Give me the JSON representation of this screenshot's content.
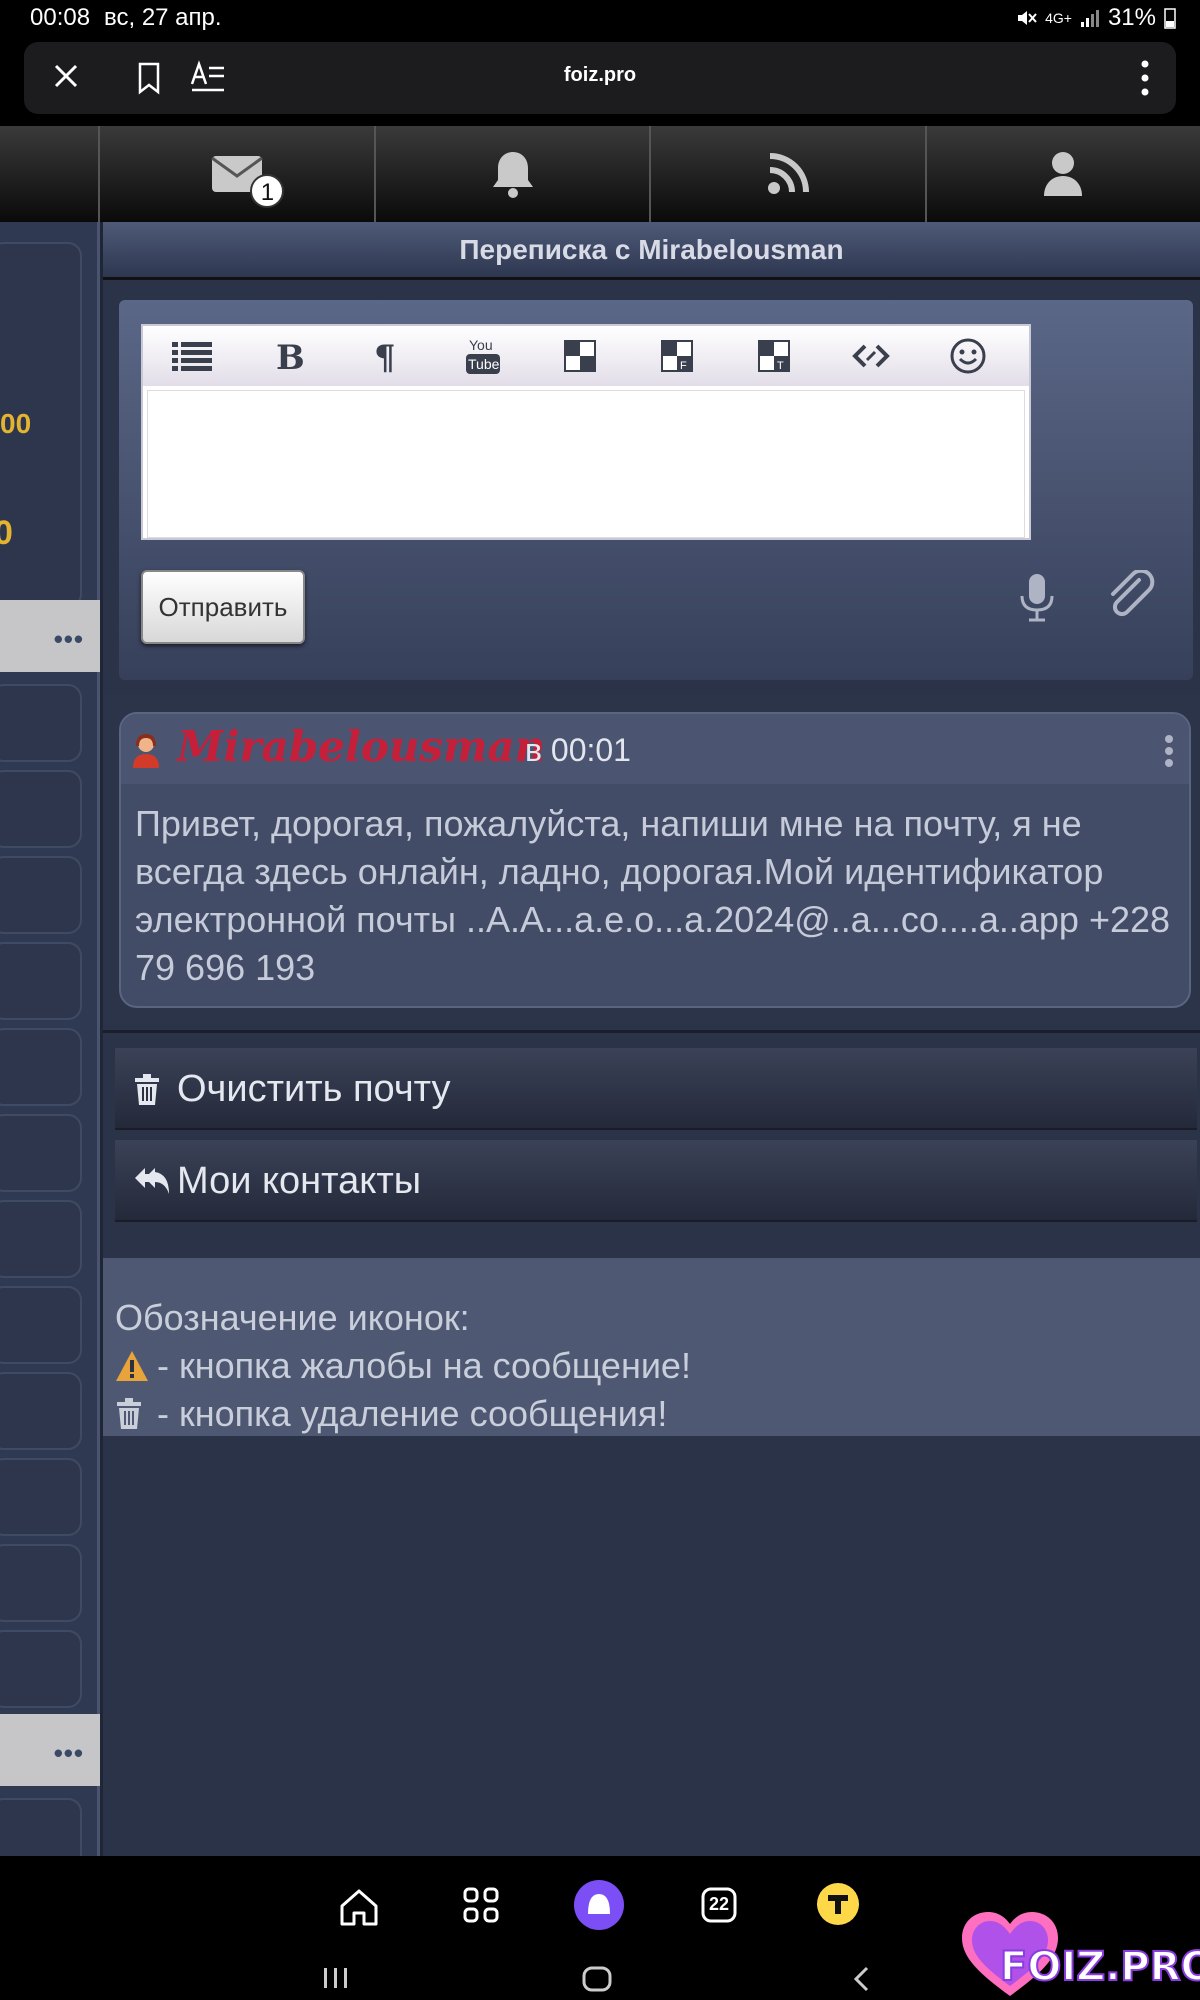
{
  "status_bar": {
    "time": "00:08",
    "date": "вс, 27 апр.",
    "network": "4G+",
    "battery": "31%"
  },
  "browser": {
    "url": "foiz.pro"
  },
  "top_nav": {
    "mail_badge": "1"
  },
  "sidebar": {
    "gold_text_1": "00",
    "gold_text_2": "0",
    "more_dots": "•••"
  },
  "page": {
    "title": "Переписка с Mirabelousman"
  },
  "compose": {
    "send_label": "Отправить",
    "toolbar_icons": [
      "list-icon",
      "bold-icon",
      "paragraph-icon",
      "youtube-icon",
      "checkerboard-icon",
      "checkerboard-f-icon",
      "checkerboard-t-icon",
      "link-icon",
      "smiley-icon"
    ],
    "youtube_top": "You",
    "youtube_bottom": "Tube"
  },
  "message": {
    "author": "Mirabelousman",
    "time": "в 00:01",
    "text": "Привет, дорогая, пожалуйста, напиши мне на почту, я не всегда здесь онлайн, ладно, дорогая.Мой идентификатор электронной почты ..A.A...a.e.o...a.2024@..a...co....a..app +228 79 696 193"
  },
  "actions": {
    "clear_mail": "Очистить почту",
    "my_contacts": "Мои контакты"
  },
  "legend": {
    "title": "Обозначение иконок:",
    "complaint": "- кнопка жалобы на сообщение!",
    "delete": "- кнопка удаление сообщения!"
  },
  "bottom_nav": {
    "tabs_count": "22"
  },
  "watermark": {
    "text": "FOIZ.PRO"
  },
  "colors": {
    "author": "#c51f3a",
    "gold": "#e3b331",
    "warning": "#e8a33a"
  }
}
